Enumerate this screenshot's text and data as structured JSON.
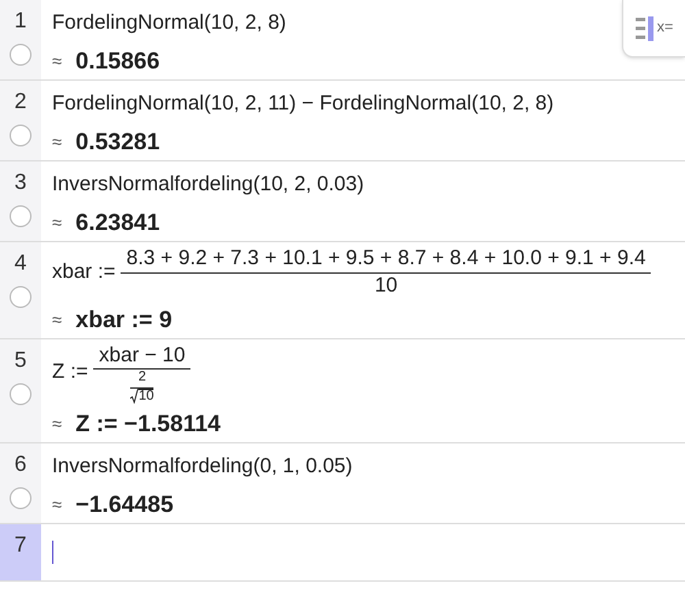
{
  "toggle_button": {
    "label": "x="
  },
  "rows": [
    {
      "number": "1",
      "selected": false,
      "shown": false,
      "input": {
        "kind": "text",
        "text": "FordelingNormal(10, 2, 8)"
      },
      "output": {
        "approx": "≈",
        "value": "0.15866"
      }
    },
    {
      "number": "2",
      "selected": false,
      "shown": false,
      "input": {
        "kind": "text",
        "text": "FordelingNormal(10, 2, 11) − FordelingNormal(10, 2, 8)"
      },
      "output": {
        "approx": "≈",
        "value": "0.53281"
      }
    },
    {
      "number": "3",
      "selected": false,
      "shown": false,
      "input": {
        "kind": "text",
        "text": "InversNormalfordeling(10, 2, 0.03)"
      },
      "output": {
        "approx": "≈",
        "value": "6.23841"
      }
    },
    {
      "number": "4",
      "selected": false,
      "shown": false,
      "input": {
        "kind": "fraction",
        "lhs": "xbar :=",
        "numerator": "8.3 + 9.2 + 7.3 + 10.1 + 9.5 + 8.7 + 8.4 + 10.0 + 9.1 + 9.4",
        "denominator": {
          "kind": "text",
          "text": "10"
        }
      },
      "output": {
        "approx": "≈",
        "value": "xbar := 9"
      }
    },
    {
      "number": "5",
      "selected": false,
      "shown": false,
      "input": {
        "kind": "fraction",
        "lhs": "Z :=",
        "numerator": "xbar − 10",
        "denominator": {
          "kind": "fraction",
          "numerator": "2",
          "radicand": "10"
        }
      },
      "output": {
        "approx": "≈",
        "value": "Z := −1.58114"
      }
    },
    {
      "number": "6",
      "selected": false,
      "shown": false,
      "input": {
        "kind": "text",
        "text": "InversNormalfordeling(0, 1, 0.05)"
      },
      "output": {
        "approx": "≈",
        "value": "−1.64485"
      }
    },
    {
      "number": "7",
      "selected": true,
      "input": {
        "kind": "empty"
      }
    }
  ]
}
